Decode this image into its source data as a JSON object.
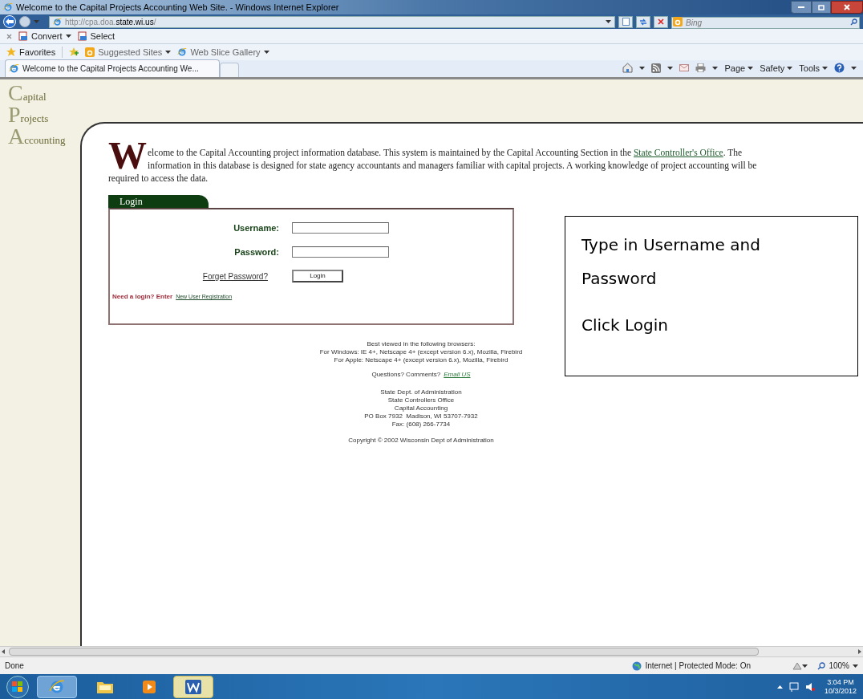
{
  "window": {
    "title": "Welcome to the Capital Projects Accounting Web Site. - Windows Internet Explorer"
  },
  "address_bar": {
    "url_prefix": "http://cpa.doa.",
    "url_domain": "state.wi.us",
    "url_suffix": "/"
  },
  "search": {
    "placeholder": "Bing"
  },
  "command_bar": {
    "items": [
      {
        "label": "Convert",
        "dropdown": true
      },
      {
        "label": "Select",
        "dropdown": false
      }
    ]
  },
  "favorites_bar": {
    "favorites": "Favorites",
    "items": [
      {
        "label": "Suggested Sites"
      },
      {
        "label": "Web Slice Gallery"
      }
    ]
  },
  "tabs": [
    {
      "label": "Welcome to the Capital Projects Accounting We...",
      "selected": true
    }
  ],
  "tools": [
    "Page",
    "Safety",
    "Tools"
  ],
  "logo": [
    "Capital",
    "Projects",
    "Accounting"
  ],
  "welcome": {
    "drop_cap": "W",
    "before": "elcome to the Capital Accounting project information database. This system is maintained by the Capital Accounting Section in the",
    "link": "State Controller's Office",
    "after": ". The information in this database is designed for state agency accountants and managers familiar with capital projects. A working knowledge of project accounting will be required to access the data."
  },
  "login": {
    "title": "Login",
    "fields": [
      {
        "label": "Username:"
      },
      {
        "label": "Password:"
      }
    ],
    "forgot": "Forget Password?",
    "button": "Login",
    "register_prompt": "Need a login? Enter",
    "register_link": "New User Registration"
  },
  "footer": {
    "browsers": [
      "Best viewed in the following browsers:",
      "For Windows: IE 4+, Netscape 4+ (except version 6.x), Mozilla, Firebird",
      "For Apple: Netscape 4+ (except version 6.x), Mozilla, Firebird"
    ],
    "questions": "Questions? Comments?",
    "email": "Email US",
    "address": [
      "State Dept. of Administration",
      "State Controllers Office",
      "Capital Accounting",
      "PO Box 7932  Madison, WI 53707-7932",
      "Fax: (608) 266-7734"
    ],
    "copyright": "Copyright © 2002 Wisconsin Dept of Administration"
  },
  "callout": {
    "lines": [
      "Type in Username and Password",
      "Click Login"
    ]
  },
  "status_bar": {
    "status": "Done",
    "zone": "Internet | Protected Mode: On",
    "zoom": "100%"
  },
  "taskbar": {
    "time": "3:04 PM",
    "date": "10/3/2012"
  }
}
